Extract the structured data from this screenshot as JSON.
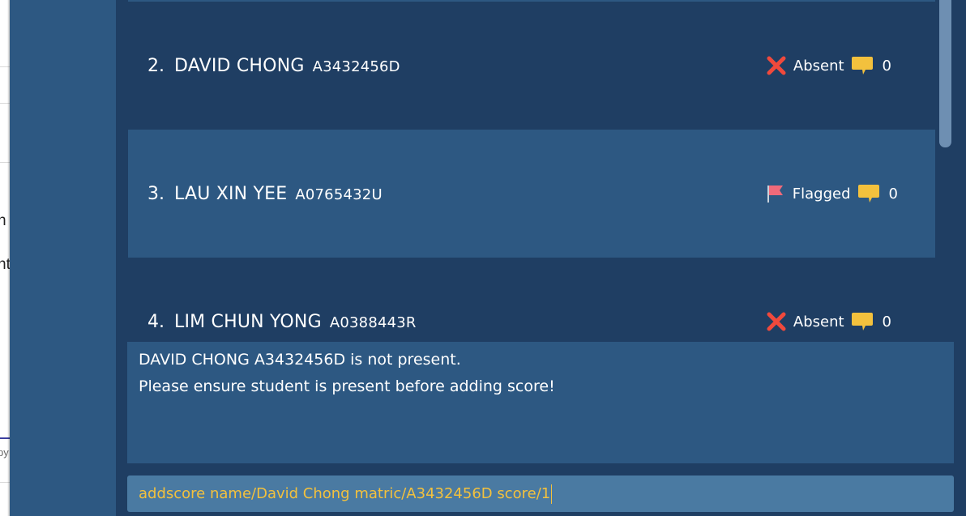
{
  "background_window": {
    "fragments": [
      "n",
      "nt.",
      "py"
    ]
  },
  "students": [
    {
      "index": "2.",
      "name": "DAVID CHONG",
      "matric": "A3432456D",
      "status": "Absent",
      "status_icon": "cross-icon",
      "comments": "0"
    },
    {
      "index": "3.",
      "name": "LAU XIN YEE",
      "matric": "A0765432U",
      "status": "Flagged",
      "status_icon": "flag-icon",
      "comments": "0"
    },
    {
      "index": "4.",
      "name": "LIM CHUN YONG",
      "matric": "A0388443R",
      "status": "Absent",
      "status_icon": "cross-icon",
      "comments": "0"
    }
  ],
  "result": {
    "line1": "DAVID CHONG A3432456D is not present.",
    "line2": "Please ensure student is present before adding score!"
  },
  "command": {
    "value": "addscore name/David Chong matric/A3432456D score/1"
  },
  "colors": {
    "list_background": "#1f3e63",
    "card_alt_background": "#2d5882",
    "command_text": "#f3c13d",
    "absent_icon": "#f0493c",
    "flag_icon": "#ef6a7a",
    "comment_icon": "#f3c13d"
  }
}
